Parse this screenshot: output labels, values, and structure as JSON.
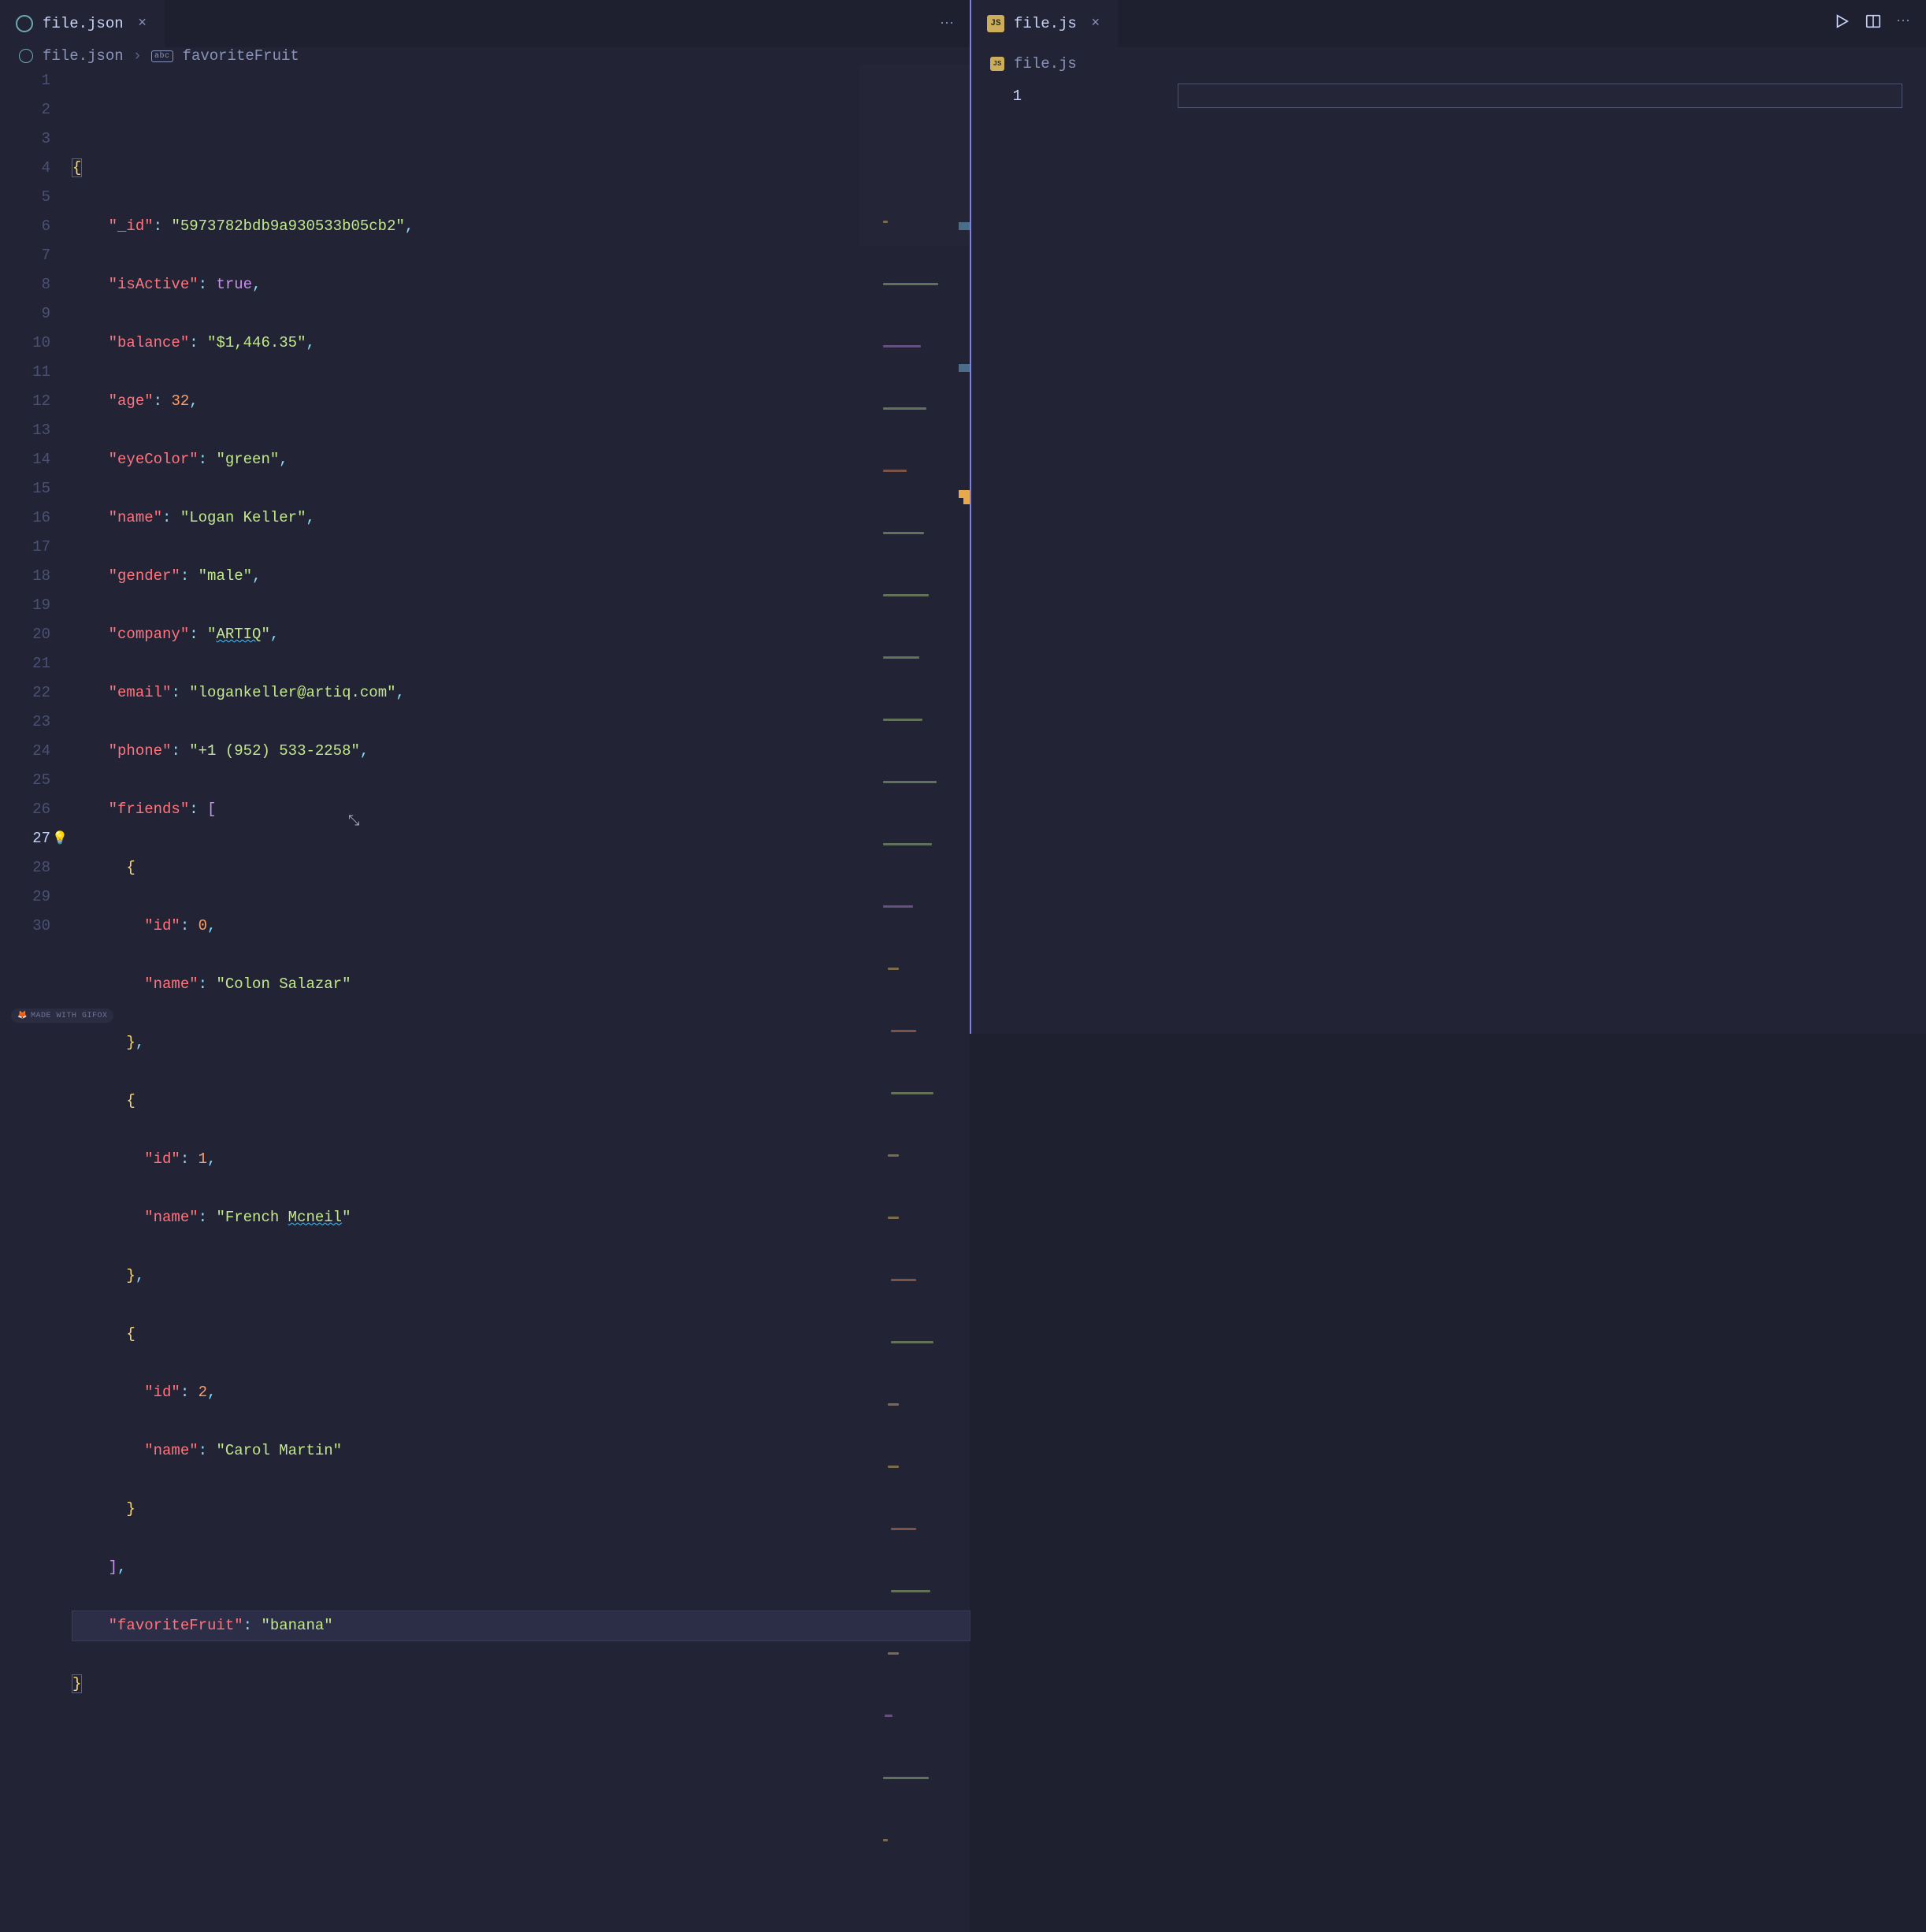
{
  "left": {
    "tab": {
      "name": "file.json",
      "icon": "json-icon"
    },
    "breadcrumb": {
      "file": "file.json",
      "symbol": "favoriteFruit"
    },
    "lines": 30,
    "highlight_line": 27,
    "code": {
      "l1": "",
      "l2_open": "{",
      "id_key": "\"_id\"",
      "id_val": "\"5973782bdb9a930533b05cb2\"",
      "isActive_key": "\"isActive\"",
      "isActive_val": "true",
      "balance_key": "\"balance\"",
      "balance_val": "\"$1,446.35\"",
      "age_key": "\"age\"",
      "age_val": "32",
      "eyeColor_key": "\"eyeColor\"",
      "eyeColor_val": "\"green\"",
      "name_key": "\"name\"",
      "name_val": "\"Logan Keller\"",
      "gender_key": "\"gender\"",
      "gender_val": "\"male\"",
      "company_key": "\"company\"",
      "company_val_pre": "\"",
      "company_val_mid": "ARTIQ",
      "company_val_post": "\"",
      "email_key": "\"email\"",
      "email_val": "\"logankeller@artiq.com\"",
      "phone_key": "\"phone\"",
      "phone_val": "\"+1 (952) 533-2258\"",
      "friends_key": "\"friends\"",
      "friend0_id_key": "\"id\"",
      "friend0_id_val": "0",
      "friend0_name_key": "\"name\"",
      "friend0_name_val": "\"Colon Salazar\"",
      "friend1_id_key": "\"id\"",
      "friend1_id_val": "1",
      "friend1_name_key": "\"name\"",
      "friend1_name_val_pre": "\"French ",
      "friend1_name_val_mid": "Mcneil",
      "friend1_name_val_post": "\"",
      "friend2_id_key": "\"id\"",
      "friend2_id_val": "2",
      "friend2_name_key": "\"name\"",
      "friend2_name_val": "\"Carol Martin\"",
      "favFruit_key": "\"favoriteFruit\"",
      "favFruit_val": "\"banana\"",
      "close_brace": "}"
    }
  },
  "right": {
    "tab": {
      "name": "file.js",
      "icon": "js-icon"
    },
    "breadcrumb": {
      "file": "file.js"
    },
    "lines": 1
  },
  "badge": "MADE WITH GIFOX"
}
